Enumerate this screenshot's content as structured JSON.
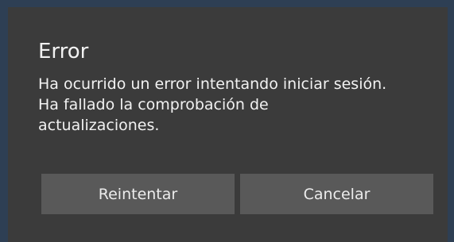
{
  "dialog": {
    "title": "Error",
    "message_lines": [
      "Ha ocurrido un error intentando iniciar sesión.",
      "Ha fallado la comprobación de",
      "actualizaciones."
    ],
    "retry_label": "Reintentar",
    "cancel_label": "Cancelar"
  },
  "colors": {
    "background": "#3b3b3b",
    "frame": "#2e3f54",
    "button": "#595959",
    "text": "#f2f2f2"
  }
}
